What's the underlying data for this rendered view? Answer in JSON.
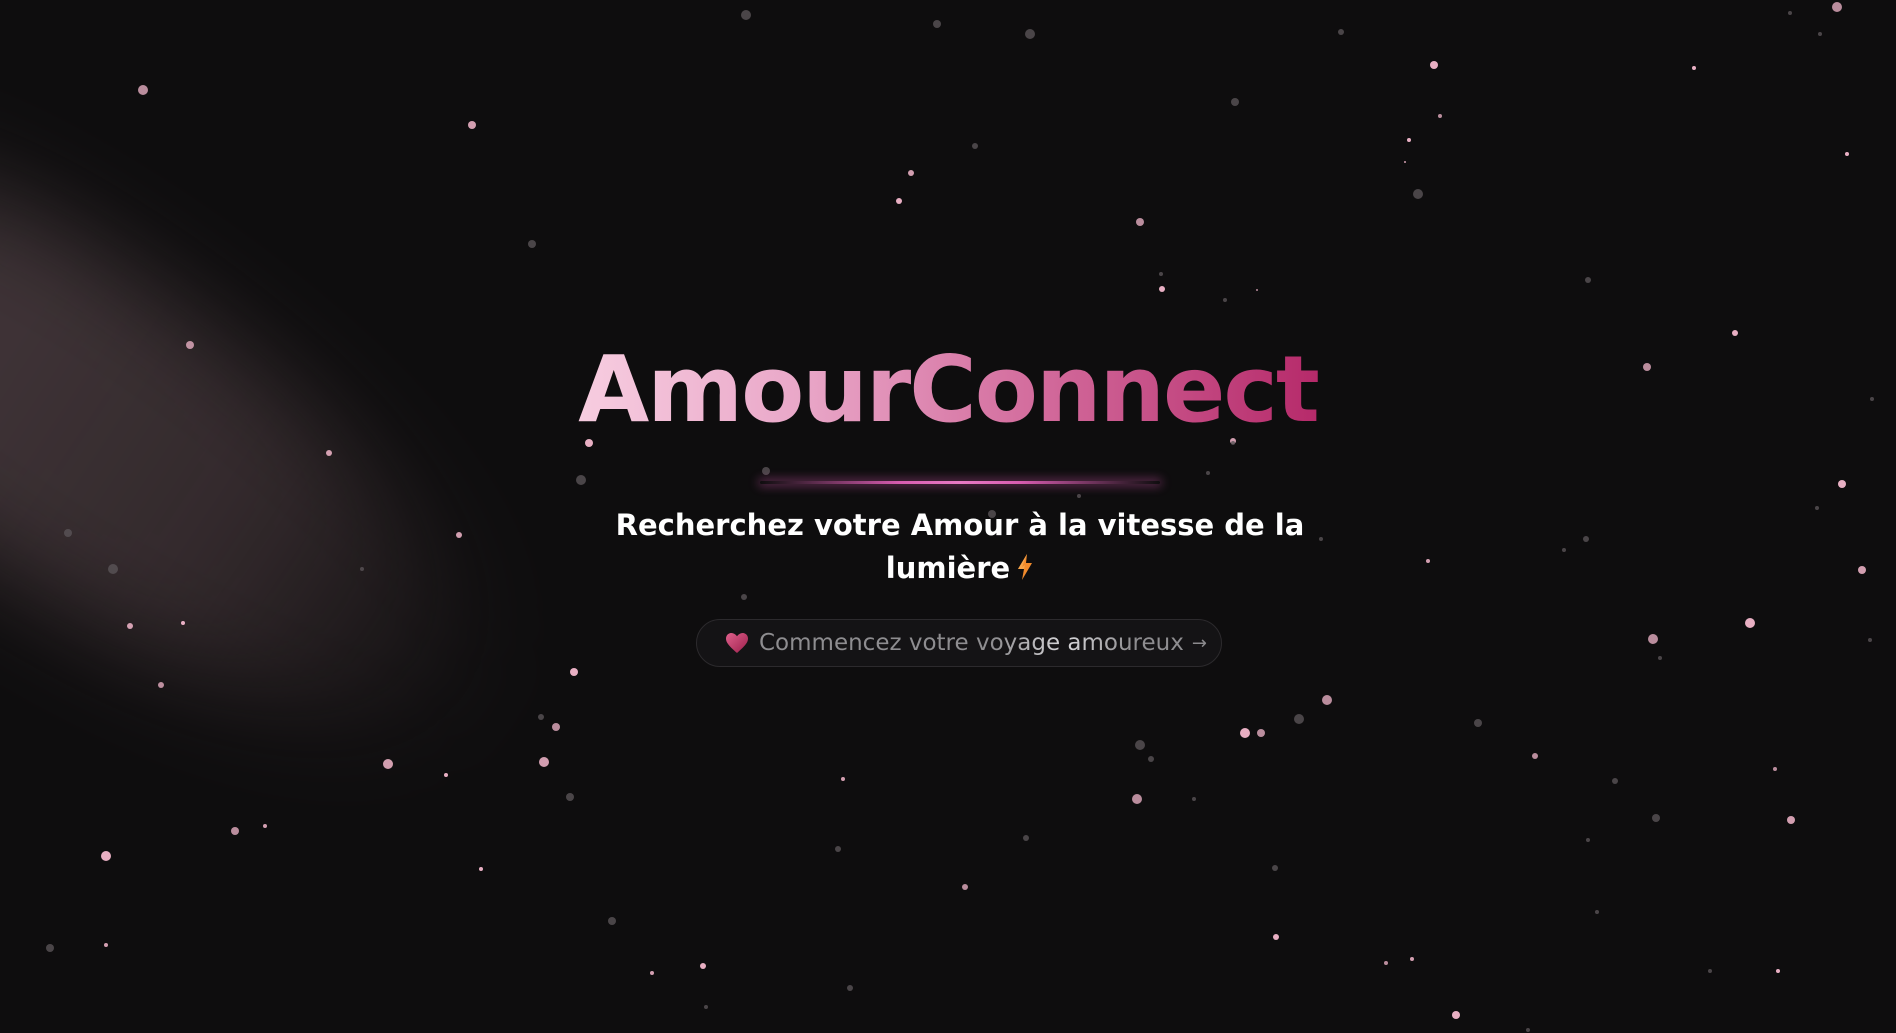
{
  "app": {
    "title": "AmourConnect",
    "subtitle": "Recherchez votre Amour à la vitesse de la lumière",
    "subtitle_icon": "lightning-bolt-icon"
  },
  "cta": {
    "icon": "heart-icon",
    "label": "Commencez votre voyage amoureux",
    "arrow": "→"
  },
  "colors": {
    "background": "#0e0d0e",
    "title_gradient_start": "#f7cde0",
    "title_gradient_end": "#b62a6a",
    "accent_line": "#e77ac4",
    "star_bright": "#f4b8cd",
    "star_dim": "#5a5458"
  }
}
